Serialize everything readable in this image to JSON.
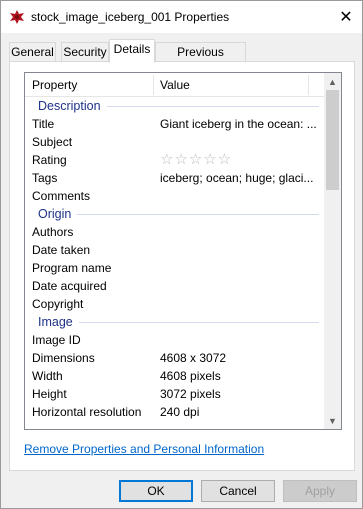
{
  "window": {
    "title": "stock_image_iceberg_001 Properties",
    "close_glyph": "✕"
  },
  "tabs": [
    {
      "label": "General"
    },
    {
      "label": "Security"
    },
    {
      "label": "Details"
    },
    {
      "label": "Previous Versions"
    }
  ],
  "active_tab": "Details",
  "table": {
    "col_property": "Property",
    "col_value": "Value"
  },
  "groups": {
    "description": {
      "label": "Description",
      "rows": [
        {
          "key": "Title",
          "value": "Giant iceberg in the ocean: ..."
        },
        {
          "key": "Subject",
          "value": ""
        },
        {
          "key": "Rating",
          "value": ""
        },
        {
          "key": "Tags",
          "value": "iceberg; ocean; huge; glaci..."
        },
        {
          "key": "Comments",
          "value": ""
        }
      ]
    },
    "origin": {
      "label": "Origin",
      "rows": [
        {
          "key": "Authors",
          "value": ""
        },
        {
          "key": "Date taken",
          "value": ""
        },
        {
          "key": "Program name",
          "value": ""
        },
        {
          "key": "Date acquired",
          "value": ""
        },
        {
          "key": "Copyright",
          "value": ""
        }
      ]
    },
    "image": {
      "label": "Image",
      "rows": [
        {
          "key": "Image ID",
          "value": ""
        },
        {
          "key": "Dimensions",
          "value": "4608 x 3072"
        },
        {
          "key": "Width",
          "value": "4608 pixels"
        },
        {
          "key": "Height",
          "value": "3072 pixels"
        },
        {
          "key": "Horizontal resolution",
          "value": "240 dpi"
        }
      ]
    }
  },
  "rating": {
    "stars_filled": 0,
    "stars_total": 5,
    "star_glyph": "☆☆☆☆☆"
  },
  "link_remove": "Remove Properties and Personal Information",
  "buttons": {
    "ok": "OK",
    "cancel": "Cancel",
    "apply": "Apply"
  },
  "colors": {
    "group_header": "#1e3287",
    "link": "#0066cc",
    "accent": "#0078d7"
  },
  "icons": {
    "title": "image-file-icon",
    "close": "close-icon"
  }
}
